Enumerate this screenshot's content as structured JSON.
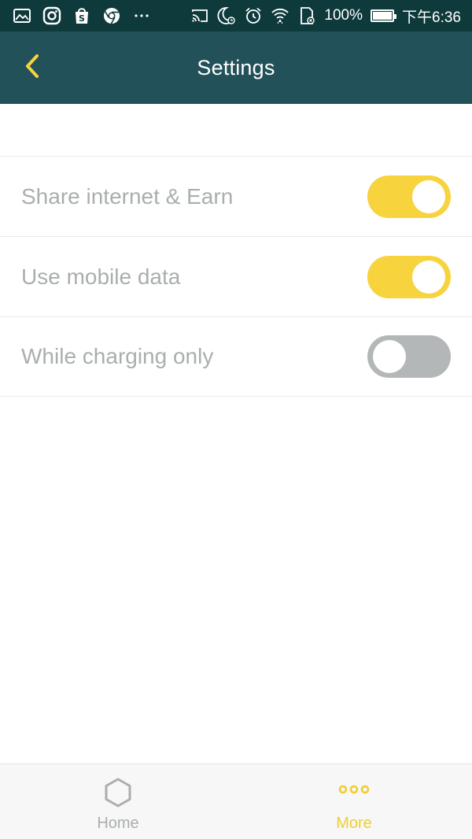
{
  "status_bar": {
    "left_icons": [
      "gallery-icon",
      "instagram-icon",
      "shopee-icon",
      "chrome-icon",
      "more-dots-icon"
    ],
    "right_icons": [
      "cast-icon",
      "do-not-disturb-icon",
      "alarm-icon",
      "wifi-icon",
      "sd-card-icon",
      "battery-icon"
    ],
    "battery": "100%",
    "time": "下午6:36"
  },
  "header": {
    "title": "Settings",
    "back_icon": "chevron-left-icon",
    "accent": "#f7d33e"
  },
  "settings": [
    {
      "label": "Share internet & Earn",
      "state": "on"
    },
    {
      "label": "Use mobile data",
      "state": "on"
    },
    {
      "label": "While charging only",
      "state": "off"
    }
  ],
  "bottom_nav": {
    "items": [
      {
        "label": "Home",
        "icon": "hexagon-icon",
        "active": false
      },
      {
        "label": "More",
        "icon": "three-dots-icon",
        "active": true
      }
    ]
  },
  "colors": {
    "status_bar": "#0f3a3c",
    "app_bar": "#22515a",
    "toggle_on": "#f7d33e",
    "toggle_off": "#b3b7b8",
    "label_text": "#a9aeaf",
    "active_nav": "#f2cd2f"
  }
}
